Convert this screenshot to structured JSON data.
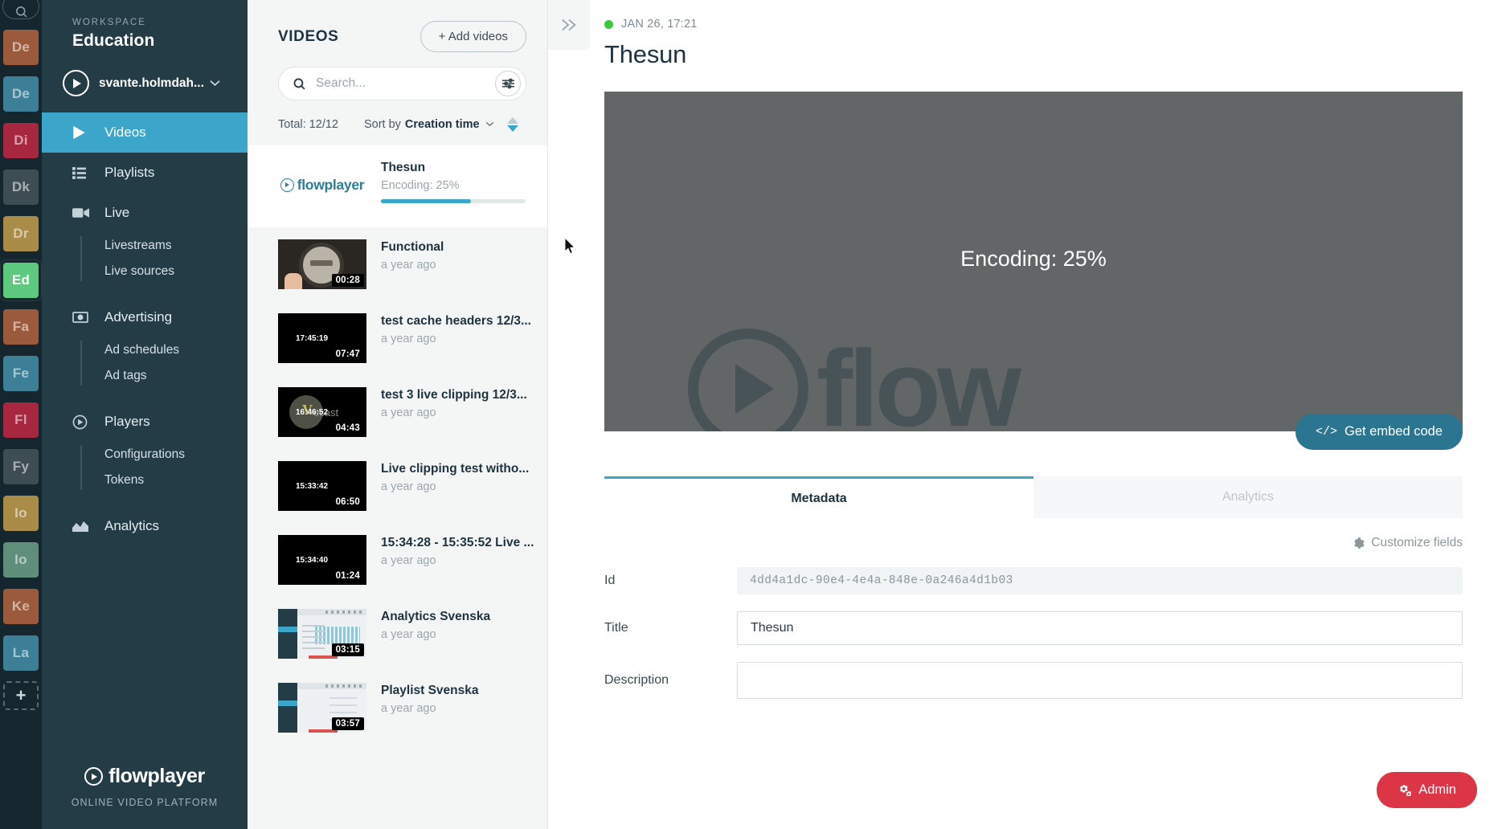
{
  "rail": {
    "search_icon": "search-icon",
    "add_label": "+",
    "items": [
      {
        "label": "De",
        "color": "#9c5a3c",
        "active": false
      },
      {
        "label": "De",
        "color": "#3d7f97",
        "active": false
      },
      {
        "label": "Di",
        "color": "#a6273f",
        "active": false
      },
      {
        "label": "Dk",
        "color": "#3e4c54",
        "active": false
      },
      {
        "label": "Dr",
        "color": "#a98c47",
        "active": false
      },
      {
        "label": "Ed",
        "color": "#5dc97f",
        "active": true
      },
      {
        "label": "Fa",
        "color": "#9c5a3c",
        "active": false
      },
      {
        "label": "Fe",
        "color": "#3d7f97",
        "active": false
      },
      {
        "label": "Fl",
        "color": "#a6273f",
        "active": false
      },
      {
        "label": "Fy",
        "color": "#3e4c54",
        "active": false
      },
      {
        "label": "Io",
        "color": "#a98c47",
        "active": false
      },
      {
        "label": "Io",
        "color": "#5f8f7a",
        "active": false
      },
      {
        "label": "Ke",
        "color": "#9c5a3c",
        "active": false
      },
      {
        "label": "La",
        "color": "#3d7f97",
        "active": false
      }
    ]
  },
  "sidebar": {
    "workspace_label": "WORKSPACE",
    "workspace_name": "Education",
    "user_name": "svante.holmdah...",
    "nav": [
      {
        "label": "Videos",
        "icon": "play-triangle-icon",
        "active": true
      },
      {
        "label": "Playlists",
        "icon": "list-icon",
        "active": false
      },
      {
        "label": "Live",
        "icon": "video-camera-icon",
        "active": false
      }
    ],
    "live_sub": [
      "Livestreams",
      "Live sources"
    ],
    "advertising": {
      "label": "Advertising",
      "icon": "banknote-icon"
    },
    "advertising_sub": [
      "Ad schedules",
      "Ad tags"
    ],
    "players": {
      "label": "Players",
      "icon": "play-circle-icon"
    },
    "players_sub": [
      "Configurations",
      "Tokens"
    ],
    "analytics": {
      "label": "Analytics",
      "icon": "area-chart-icon"
    },
    "brand_name": "flowplayer",
    "brand_tagline": "ONLINE VIDEO PLATFORM"
  },
  "list": {
    "title": "VIDEOS",
    "add_videos_label": "+ Add videos",
    "search_placeholder": "Search...",
    "search_value": "",
    "filter_icon": "sliders-icon",
    "total": "Total: 12/12",
    "sort_label": "Sort by",
    "sort_value": "Creation time",
    "collapse_icon": "double-chevron-right-icon",
    "items": [
      {
        "title": "Thesun",
        "sub": "Encoding: 25%",
        "duration": "",
        "timestamp": "",
        "progress": 62,
        "kind": "encoding"
      },
      {
        "title": "Functional",
        "sub": "a year ago",
        "duration": "00:28",
        "timestamp": "",
        "kind": "photo"
      },
      {
        "title": "test cache headers 12/3...",
        "sub": "a year ago",
        "duration": "07:47",
        "timestamp": "17:45:19",
        "kind": "black"
      },
      {
        "title": "test 3 live clipping 12/3...",
        "sub": "a year ago",
        "duration": "04:43",
        "timestamp": "16:46:52",
        "kind": "wirecast"
      },
      {
        "title": "Live clipping test witho...",
        "sub": "a year ago",
        "duration": "06:50",
        "timestamp": "15:33:42",
        "kind": "black"
      },
      {
        "title": "15:34:28 - 15:35:52 Live ...",
        "sub": "a year ago",
        "duration": "01:24",
        "timestamp": "15:34:40",
        "kind": "black"
      },
      {
        "title": "Analytics Svenska",
        "sub": "a year ago",
        "duration": "03:15",
        "timestamp": "",
        "kind": "ui-analytics"
      },
      {
        "title": "Playlist Svenska",
        "sub": "a year ago",
        "duration": "03:57",
        "timestamp": "",
        "kind": "ui-playlist"
      }
    ]
  },
  "detail": {
    "status_date": "JAN 26, 17:21",
    "status_color": "#3ec73e",
    "title": "Thesun",
    "player_status": "Encoding: 25%",
    "watermark": "flow",
    "embed_label": "Get embed code",
    "embed_icon": "</>",
    "tabs": [
      {
        "label": "Metadata",
        "active": true
      },
      {
        "label": "Analytics",
        "active": false
      }
    ],
    "customize_label": "Customize fields",
    "customize_icon": "gear-icon",
    "fields": [
      {
        "label": "Id",
        "value": "4dd4a1dc-90e4-4e4a-848e-0a246a4d1b03",
        "readonly": true
      },
      {
        "label": "Title",
        "value": "Thesun",
        "readonly": false
      },
      {
        "label": "Description",
        "value": "",
        "readonly": false
      }
    ],
    "admin_label": "Admin",
    "admin_icon": "gears-icon",
    "admin_color": "#dc3545"
  }
}
